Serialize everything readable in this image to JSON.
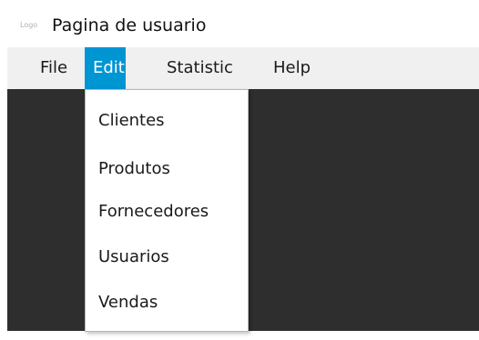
{
  "window": {
    "title": "Pagina de usuario",
    "icon_text": "Logo",
    "icon_name": "app-logo-icon"
  },
  "menubar": {
    "items": [
      {
        "label": "File"
      },
      {
        "label": "Edit",
        "active": true
      },
      {
        "label": "Statistic"
      },
      {
        "label": "Help"
      }
    ]
  },
  "edit_menu": {
    "items": [
      {
        "label": "Clientes"
      },
      {
        "label": "Produtos"
      },
      {
        "label": "Fornecedores"
      },
      {
        "label": "Usuarios"
      },
      {
        "label": "Vendas"
      }
    ]
  },
  "colors": {
    "accent": "#0095d3",
    "menubar_bg": "#f0f0f0",
    "content_bg": "#2e2e2e"
  }
}
